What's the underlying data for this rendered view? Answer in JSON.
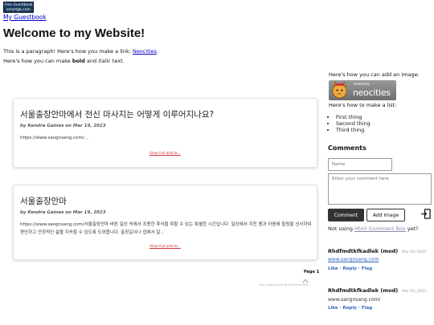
{
  "guestbook_badge": {
    "line1": "Free Guestbook",
    "line2": "smartgb.com"
  },
  "guestbook_link": "My Guestbook",
  "page_title": "Welcome to my Website!",
  "para1": {
    "before": "This is a paragraph! Here's how you make a link: ",
    "link": "Neocities",
    "after": "."
  },
  "para2": {
    "before": "Here's how you can make ",
    "bold": "bold",
    "middle": " and ",
    "italic": "italic",
    "after": " text."
  },
  "posts": [
    {
      "title": "서울출장안마에서 전신 마사지는 어떻게 이루어지나요?",
      "meta": "by Kendra Gaines on Mar 19, 2023",
      "body": "https://www.sangnsang.com/...",
      "more": "View full article..."
    },
    {
      "title": "서울출장안마",
      "meta": "by Kendra Gaines on Mar 19, 2023",
      "body": "https://www.sangnsang.com/서울출장안마 바쁜 일상 속에서 조용한 휴식을 취할 수 있는 특별한 시간입니다. 일상에서 지친 몸과 마음에 힐링을 선사하여 편안하고 안정적인 삶을 지속할 수 있도록 도와줍니다. 출장길이나 집에서 일...",
      "more": "View full article..."
    }
  ],
  "pager": "Page 1",
  "blog_footer": "Get a blog widget ❀ Htmlcomment",
  "sidebar": {
    "image_text": "Here's how you can add an image:",
    "hosted_small": "hosted by",
    "hosted_big": "neocities",
    "list_text": "Here's how to make a list:",
    "list_items": [
      "First thing",
      "Second thing",
      "Third thing"
    ]
  },
  "comments": {
    "title": "Comments",
    "name_placeholder": "Name",
    "comment_placeholder": "Enter your comment here",
    "comment_button": "Comment",
    "add_image_button": "Add Image",
    "not_using_before": "Not using ",
    "not_using_link": "Html Comment Box",
    "not_using_after": " yet?",
    "entries": [
      {
        "author": "Rhdfmdtkfkadlek (mod)",
        "date": "Mar 19, 2023",
        "text": "www.sangnsang.com",
        "actions": "Like · Reply · Flag"
      },
      {
        "author": "Rhdfmdtkfkadlek (mod)",
        "date": "Mar 19, 2023",
        "text": "www.sangnsang.com/",
        "actions": "Like · Reply · Flag"
      }
    ]
  },
  "colors": {
    "link": "#0000cc",
    "button_dark": "#333333",
    "action_link": "#3366bb"
  }
}
